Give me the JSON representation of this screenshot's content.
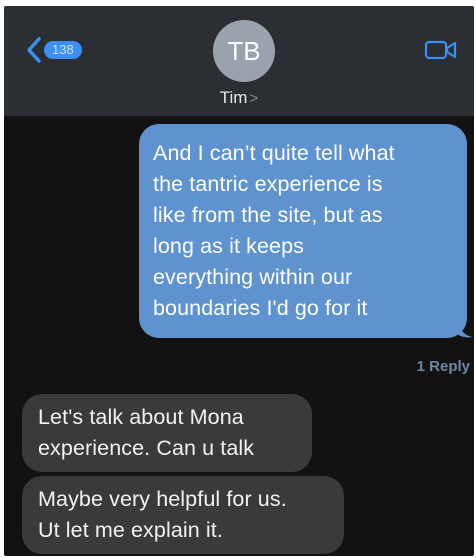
{
  "header": {
    "back_count": "138",
    "avatar_initials": "TB",
    "contact_name": "Tim",
    "name_chevron": ">"
  },
  "messages": [
    {
      "direction": "outgoing",
      "text": "And I can’t quite tell what\nthe tantric experience is\nlike from the site, but as\nlong as it keeps\neverything within our\nboundaries I'd go for it"
    },
    {
      "direction": "incoming",
      "text": "Let's talk about Mona\nexperience. Can u talk"
    },
    {
      "direction": "incoming",
      "text": "Maybe very helpful for us.\nUt let me explain it."
    }
  ],
  "reply_link": "1 Reply",
  "icons": {
    "back": "chevron-left-icon",
    "video": "video-camera-icon"
  },
  "colors": {
    "outgoing_bubble": "#5e93cf",
    "incoming_bubble": "#3a3a3c",
    "accent": "#3b8ff5",
    "header_bg": "#2b2f33",
    "background": "#121212"
  }
}
